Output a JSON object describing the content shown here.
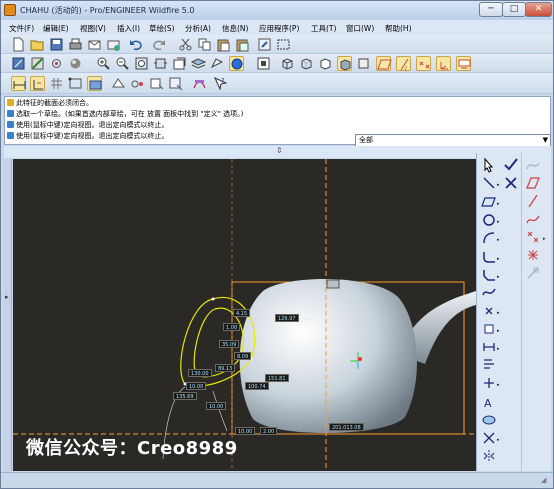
{
  "window": {
    "title": "CHAHU (活动的) - Pro/ENGINEER Wildfire 5.0",
    "buttons": {
      "minimize": "─",
      "maximize": "□",
      "close": "✕"
    }
  },
  "menu": [
    {
      "label": "文件(F)",
      "id": "file"
    },
    {
      "label": "编辑(E)",
      "id": "edit"
    },
    {
      "label": "视图(V)",
      "id": "view"
    },
    {
      "label": "插入(I)",
      "id": "insert"
    },
    {
      "label": "草绘(S)",
      "id": "sketch"
    },
    {
      "label": "分析(A)",
      "id": "analysis"
    },
    {
      "label": "信息(N)",
      "id": "info"
    },
    {
      "label": "应用程序(P)",
      "id": "applications"
    },
    {
      "label": "工具(T)",
      "id": "tools"
    },
    {
      "label": "窗口(W)",
      "id": "window"
    },
    {
      "label": "帮助(H)",
      "id": "help"
    }
  ],
  "messages": [
    "此特征的截面必须闭合。",
    "选取一个草绘。(如果首选内部草绘，可在 放置 面板中找到 \"定义\" 选项。)",
    "使用(鼠标中键)定向视图。退出定向模式以终止。",
    "使用(鼠标中键)定向视图。退出定向模式以终止。"
  ],
  "filter": {
    "value": "全部"
  },
  "watermark": "微信公众号：Creo8989",
  "dimensions": {
    "d1": "126.97",
    "d2": "151.81",
    "d3": "10.00",
    "d4": "10.00",
    "d5": "35.09",
    "d6": "1.00",
    "d7": "135.69",
    "d8": "8.09",
    "d9": "130.00",
    "d10": "89.13",
    "d11": "100.74",
    "d12": "10.00",
    "d13": "2.00",
    "d14": "4.15",
    "d15": "201.013.08"
  },
  "colors": {
    "viewport": "#2b2925",
    "sketch": "#e6e600",
    "reference": "#ff9a2e",
    "active_tool": "#f7e7a4"
  }
}
